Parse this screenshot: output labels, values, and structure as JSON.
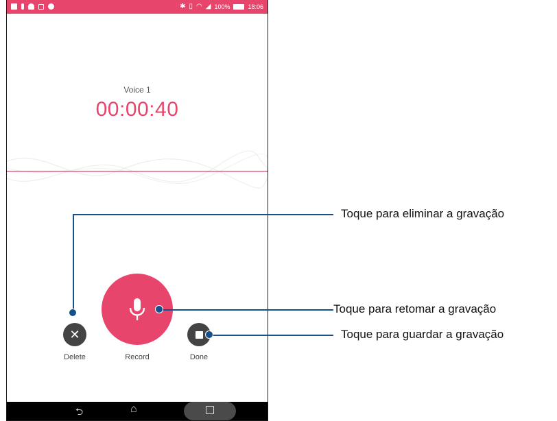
{
  "status_bar": {
    "battery_text": "100%",
    "time": "18:06"
  },
  "recording": {
    "title": "Voice 1",
    "timer": "00:00:40"
  },
  "controls": {
    "delete_label": "Delete",
    "record_label": "Record",
    "done_label": "Done"
  },
  "callouts": {
    "delete": "Toque para eliminar a gravação",
    "resume": "Toque para retomar a gravação",
    "save": "Toque para guardar a gravação"
  },
  "colors": {
    "accent": "#e8456c",
    "button_dark": "#444444",
    "callout": "#15508a"
  },
  "icons": {
    "delete": "close-icon",
    "record": "microphone-icon",
    "done": "stop-icon",
    "nav_back": "back-icon",
    "nav_home": "home-icon",
    "nav_recent": "recent-apps-icon"
  }
}
